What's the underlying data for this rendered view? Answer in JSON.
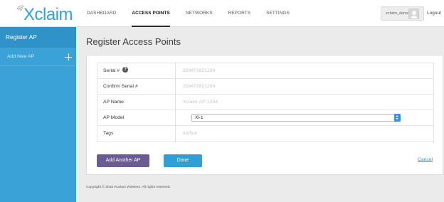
{
  "brand": {
    "logo_text": "Xclaim",
    "color": "#2fa0d8"
  },
  "nav": {
    "items": [
      {
        "label": "DASHBOARD",
        "active": false
      },
      {
        "label": "ACCESS POINTS",
        "active": true
      },
      {
        "label": "NETWORKS",
        "active": false
      },
      {
        "label": "REPORTS",
        "active": false
      },
      {
        "label": "SETTINGS",
        "active": false
      }
    ]
  },
  "user": {
    "name": "xclaim_demo",
    "logout_label": "Logout"
  },
  "sidebar": {
    "title": "Register AP",
    "add_label": "Add New AP"
  },
  "page": {
    "title": "Register Access Points"
  },
  "form": {
    "rows": [
      {
        "label": "Serial #",
        "value": "329472821294",
        "has_help": true
      },
      {
        "label": "Confirm Serial #",
        "value": "329472821294"
      },
      {
        "label": "AP Name",
        "value": "Xclaim-AP-1294"
      },
      {
        "label": "AP Model",
        "value": "Xi-1",
        "type": "select"
      },
      {
        "label": "Tags",
        "value": "#office"
      }
    ],
    "help_glyph": "?"
  },
  "actions": {
    "add_another_label": "Add Another AP",
    "done_label": "Done",
    "cancel_label": "Cancel"
  },
  "footer": {
    "copyright": "Copyright © 2015 Ruckus Wireless. All rights reserved."
  },
  "colors": {
    "sidebar": "#3aa2d7",
    "add_button": "#6a5b93",
    "done_button": "#2f9fd6",
    "link": "#2f8fd0"
  }
}
